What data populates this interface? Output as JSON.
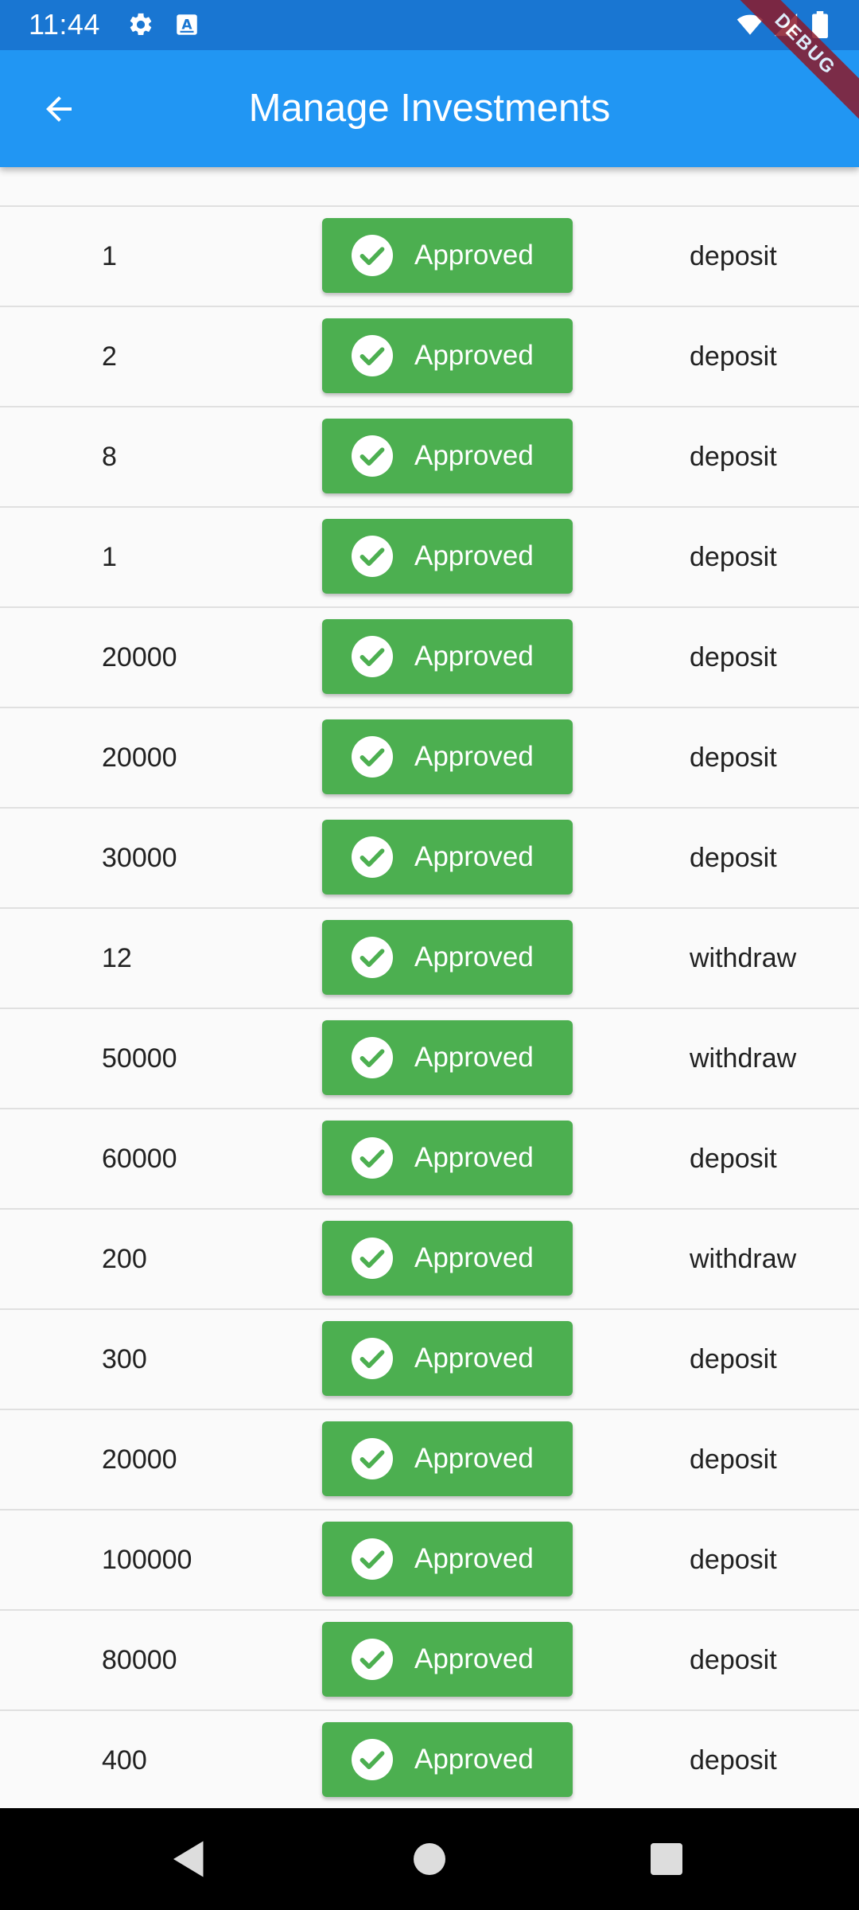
{
  "status_bar": {
    "time": "11:44",
    "left_icons": [
      "gear-icon",
      "keyboard-a-icon"
    ],
    "right_icons": [
      "wifi-icon",
      "signal-icon",
      "battery-icon"
    ]
  },
  "app_bar": {
    "title": "Manage Investments",
    "back_icon": "arrow-back-icon",
    "color": "#2196F3"
  },
  "debug_banner": "DEBUG",
  "status_button_color": "#4CAF50",
  "rows": [
    {
      "amount": "1",
      "status": "Approved",
      "type": "deposit"
    },
    {
      "amount": "2",
      "status": "Approved",
      "type": "deposit"
    },
    {
      "amount": "8",
      "status": "Approved",
      "type": "deposit"
    },
    {
      "amount": "1",
      "status": "Approved",
      "type": "deposit"
    },
    {
      "amount": "20000",
      "status": "Approved",
      "type": "deposit"
    },
    {
      "amount": "20000",
      "status": "Approved",
      "type": "deposit"
    },
    {
      "amount": "30000",
      "status": "Approved",
      "type": "deposit"
    },
    {
      "amount": "12",
      "status": "Approved",
      "type": "withdraw"
    },
    {
      "amount": "50000",
      "status": "Approved",
      "type": "withdraw"
    },
    {
      "amount": "60000",
      "status": "Approved",
      "type": "deposit"
    },
    {
      "amount": "200",
      "status": "Approved",
      "type": "withdraw"
    },
    {
      "amount": "300",
      "status": "Approved",
      "type": "deposit"
    },
    {
      "amount": "20000",
      "status": "Approved",
      "type": "deposit"
    },
    {
      "amount": "100000",
      "status": "Approved",
      "type": "deposit"
    },
    {
      "amount": "80000",
      "status": "Approved",
      "type": "deposit"
    },
    {
      "amount": "400",
      "status": "Approved",
      "type": "deposit"
    }
  ],
  "nav_bar": {
    "buttons": [
      "back-triangle-icon",
      "home-circle-icon",
      "recents-square-icon"
    ]
  }
}
